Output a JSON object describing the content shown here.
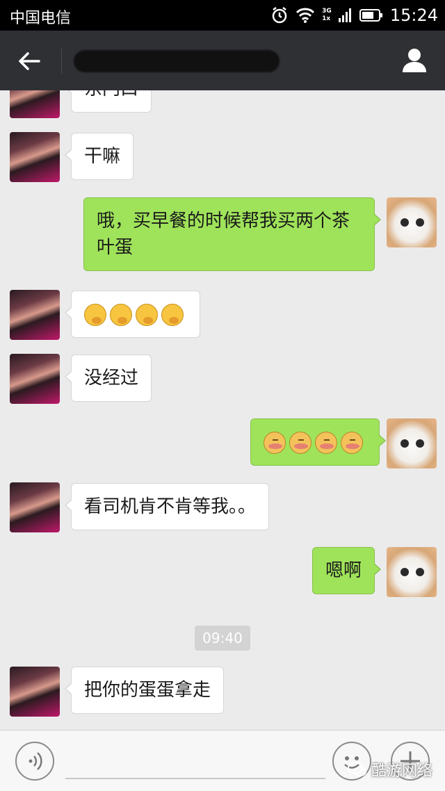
{
  "status_bar": {
    "carrier": "中国电信",
    "network": "3G",
    "network2": "1x",
    "time": "15:24"
  },
  "header": {
    "contact_name": "██████████"
  },
  "messages": [
    {
      "side": "in",
      "text": "东门口"
    },
    {
      "side": "in",
      "text": "干嘛"
    },
    {
      "side": "out",
      "text": "哦，买早餐的时候帮我买两个茶叶蛋"
    },
    {
      "side": "in",
      "emoji": [
        "thinking-emoji",
        "thinking-emoji",
        "thinking-emoji",
        "thinking-emoji"
      ]
    },
    {
      "side": "in",
      "text": "没经过"
    },
    {
      "side": "out",
      "emoji": [
        "shy-emoji",
        "shy-emoji",
        "shy-emoji",
        "shy-emoji"
      ]
    },
    {
      "side": "in",
      "text": "看司机肯不肯等我。。"
    },
    {
      "side": "out",
      "text": "嗯啊"
    },
    {
      "side": "in",
      "text": "把你的蛋蛋拿走"
    }
  ],
  "timestamp": "09:40",
  "input": {
    "value": "",
    "placeholder": ""
  },
  "watermark": "酷游网络",
  "colors": {
    "outgoing_bubble": "#9fe35a",
    "incoming_bubble": "#ffffff",
    "title_bar": "#2f3034",
    "chat_bg": "#ebebeb"
  }
}
